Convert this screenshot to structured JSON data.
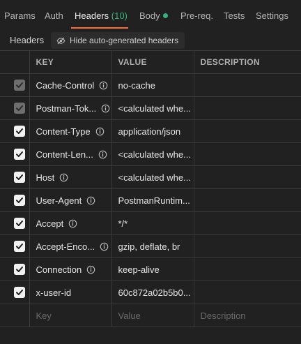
{
  "tabs": [
    {
      "label": "Params"
    },
    {
      "label": "Auth"
    },
    {
      "label": "Headers",
      "count": "(10)"
    },
    {
      "label": "Body"
    },
    {
      "label": "Pre-req."
    },
    {
      "label": "Tests"
    },
    {
      "label": "Settings"
    }
  ],
  "toolbar": {
    "title": "Headers",
    "hide_label": "Hide auto-generated headers"
  },
  "columns": {
    "key": "KEY",
    "value": "VALUE",
    "description": "DESCRIPTION"
  },
  "rows": [
    {
      "key": "Cache-Control",
      "value": "no-cache",
      "checked": true,
      "auto": true,
      "info": true
    },
    {
      "key": "Postman-Tok...",
      "value": "<calculated whe...",
      "checked": true,
      "auto": true,
      "info": true
    },
    {
      "key": "Content-Type",
      "value": "application/json",
      "checked": true,
      "auto": false,
      "info": true
    },
    {
      "key": "Content-Len...",
      "value": "<calculated whe...",
      "checked": true,
      "auto": false,
      "info": true
    },
    {
      "key": "Host",
      "value": "<calculated whe...",
      "checked": true,
      "auto": false,
      "info": true
    },
    {
      "key": "User-Agent",
      "value": "PostmanRuntim...",
      "checked": true,
      "auto": false,
      "info": true
    },
    {
      "key": "Accept",
      "value": "*/*",
      "checked": true,
      "auto": false,
      "info": true
    },
    {
      "key": "Accept-Enco...",
      "value": "gzip, deflate, br",
      "checked": true,
      "auto": false,
      "info": true
    },
    {
      "key": "Connection",
      "value": "keep-alive",
      "checked": true,
      "auto": false,
      "info": true
    },
    {
      "key": "x-user-id",
      "value": "60c872a02b5b0...",
      "checked": true,
      "auto": false,
      "info": false
    }
  ],
  "new_row": {
    "key_placeholder": "Key",
    "value_placeholder": "Value",
    "description_placeholder": "Description"
  },
  "colors": {
    "accent": "#ff6c37",
    "success": "#35b37e",
    "background": "#212121"
  }
}
